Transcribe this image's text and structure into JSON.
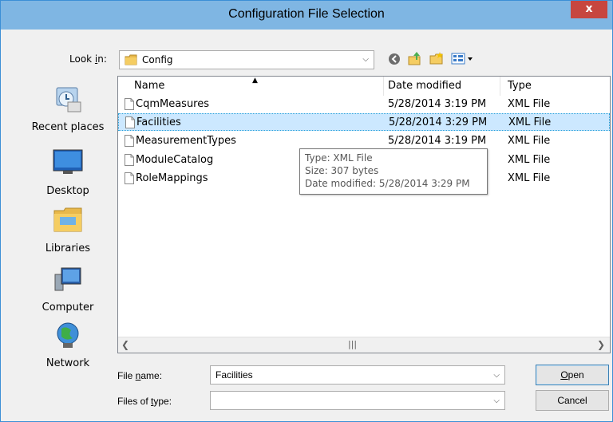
{
  "window": {
    "title": "Configuration File Selection",
    "close_label": "x"
  },
  "lookin": {
    "label_prefix": "Look ",
    "label_accel": "i",
    "label_suffix": "n:",
    "value": "Config"
  },
  "places": [
    {
      "label": "Recent places",
      "icon": "recent-places-icon"
    },
    {
      "label": "Desktop",
      "icon": "desktop-icon"
    },
    {
      "label": "Libraries",
      "icon": "libraries-icon"
    },
    {
      "label": "Computer",
      "icon": "computer-icon"
    },
    {
      "label": "Network",
      "icon": "network-icon"
    }
  ],
  "filelist": {
    "columns": [
      "Name",
      "Date modified",
      "Type"
    ],
    "rows": [
      {
        "name": "CqmMeasures",
        "date": "5/28/2014 3:19 PM",
        "type": "XML File",
        "selected": false
      },
      {
        "name": "Facilities",
        "date": "5/28/2014 3:29 PM",
        "type": "XML File",
        "selected": true
      },
      {
        "name": "MeasurementTypes",
        "date": "5/28/2014 3:19 PM",
        "type": "XML File",
        "selected": false
      },
      {
        "name": "ModuleCatalog",
        "date": "",
        "type": "XML File",
        "selected": false
      },
      {
        "name": "RoleMappings",
        "date": "",
        "type": "XML File",
        "selected": false
      }
    ]
  },
  "tooltip": {
    "type": "Type: XML File",
    "size": "Size: 307 bytes",
    "modified": "Date modified: 5/28/2014 3:29 PM"
  },
  "filename": {
    "label_prefix": "File ",
    "label_accel": "n",
    "label_suffix": "ame:",
    "value": "Facilities"
  },
  "filetype": {
    "label_prefix": "Files of ",
    "label_accel": "t",
    "label_suffix": "ype:",
    "value": ""
  },
  "buttons": {
    "open_accel": "O",
    "open_rest": "pen",
    "cancel": "Cancel"
  },
  "colors": {
    "titlebar": "#7fb6e3",
    "close": "#c7463f",
    "selection": "#cce8ff"
  }
}
